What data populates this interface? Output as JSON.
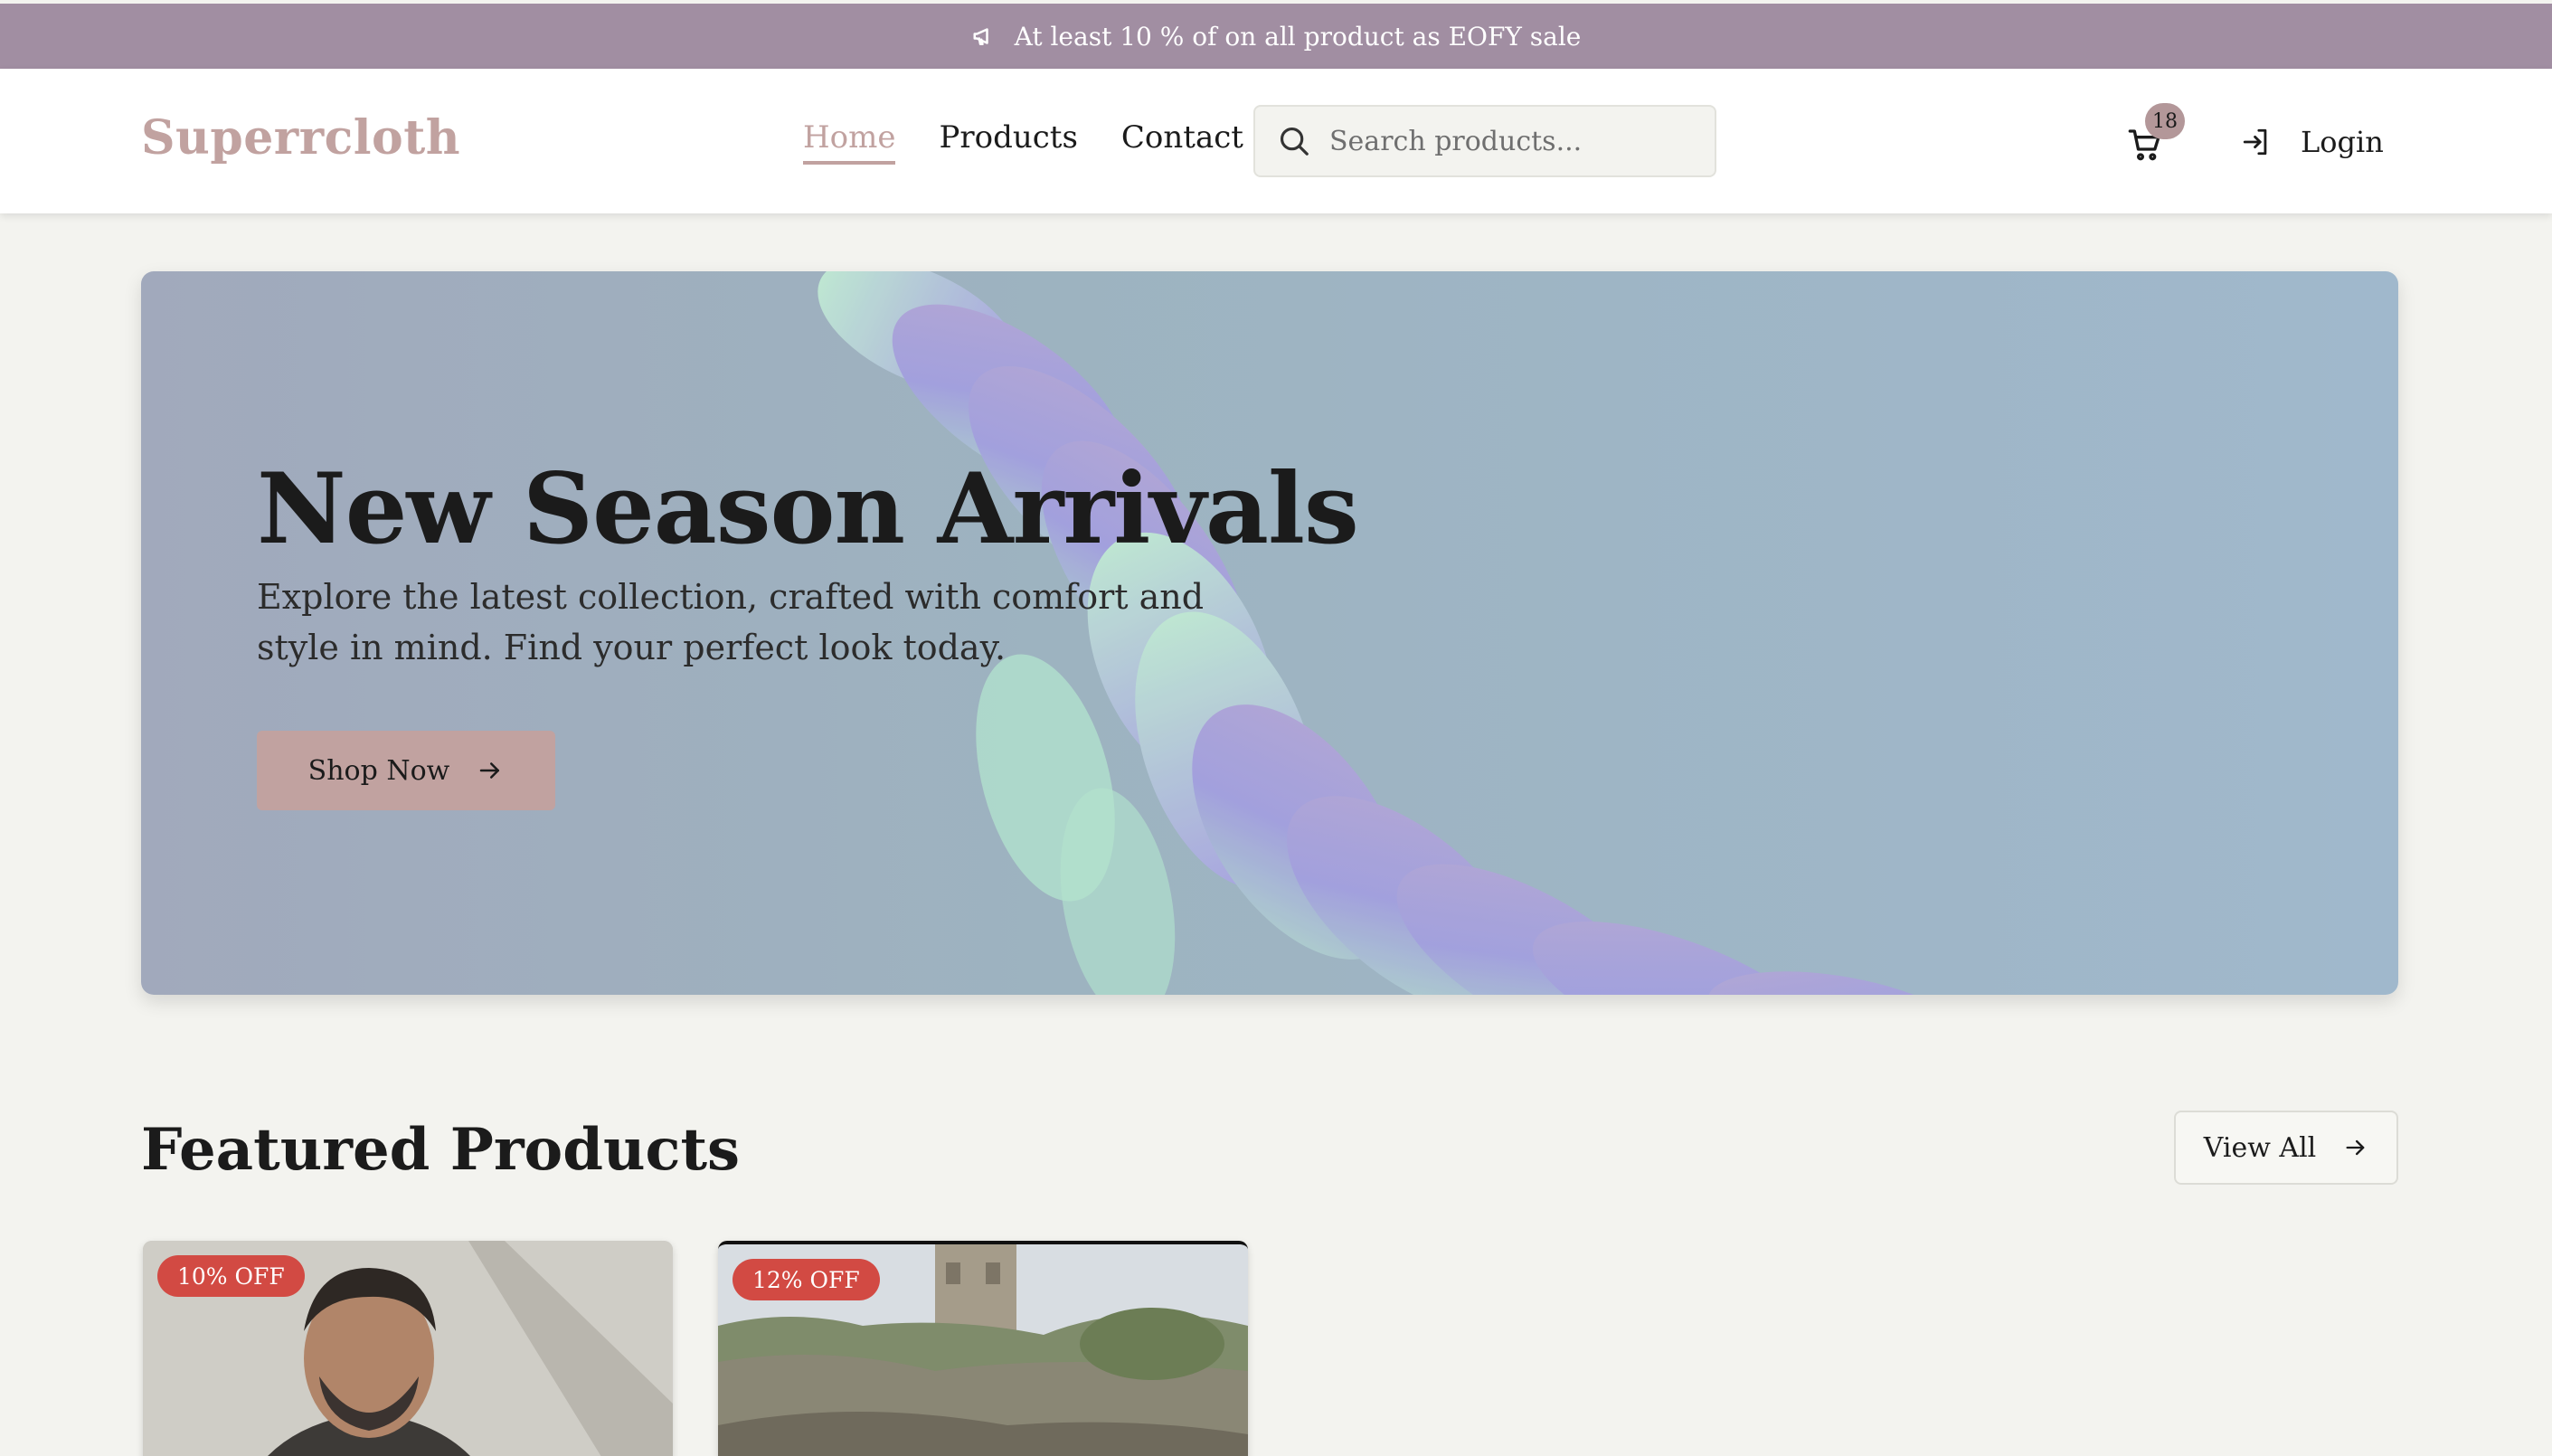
{
  "announcement": {
    "icon": "megaphone-icon",
    "text": "At least 10 % of on all product as EOFY sale"
  },
  "header": {
    "logo": "Superrcloth",
    "nav": [
      {
        "label": "Home",
        "active": true
      },
      {
        "label": "Products",
        "active": false
      },
      {
        "label": "Contact",
        "active": false
      }
    ],
    "search": {
      "placeholder": "Search products...",
      "value": ""
    },
    "cart": {
      "icon": "cart-icon",
      "count": "18"
    },
    "login": {
      "icon": "login-icon",
      "label": "Login"
    }
  },
  "hero": {
    "title": "New Season Arrivals",
    "subtitle": "Explore the latest collection, crafted with comfort and style in mind. Find your perfect look today.",
    "cta_label": "Shop Now",
    "cta_icon": "arrow-right-icon"
  },
  "featured": {
    "title": "Featured Products",
    "view_all_label": "View All",
    "products": [
      {
        "badge": "10% OFF",
        "image": "man-portrait-photo"
      },
      {
        "badge": "12% OFF",
        "image": "coastal-landscape-photo"
      }
    ]
  },
  "colors": {
    "accent": "#c1a2a0",
    "announcement_bg": "#a18ea2",
    "page_bg": "#f3f3ef",
    "badge_bg": "#d24a43"
  }
}
